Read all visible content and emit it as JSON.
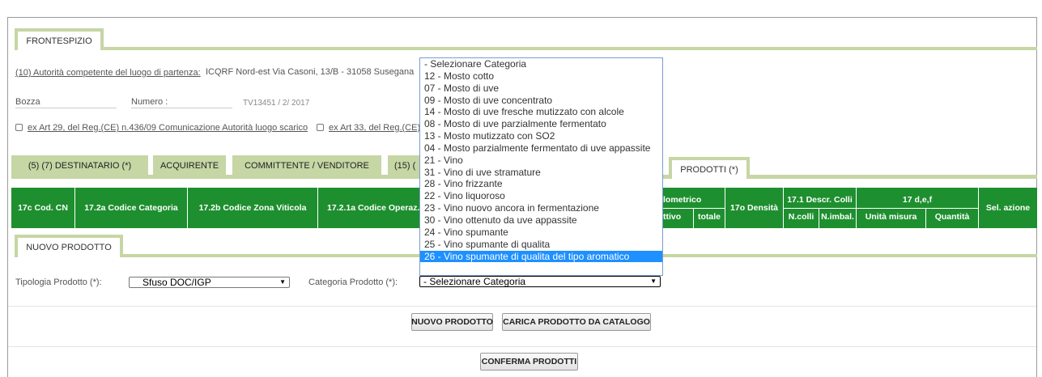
{
  "tabs": {
    "frontespizio": "FRONTESPIZIO",
    "destinatario": "(5) (7) DESTINATARIO (*)",
    "acquirente": "ACQUIRENTE",
    "committente": "COMMITTENTE / VENDITORE",
    "tab15": "(15) (",
    "prodotti": "PRODOTTI (*)",
    "nuovo_prodotto": "NUOVO PRODOTTO"
  },
  "form": {
    "autorita_label": "(10) Autorità competente del luogo di partenza:",
    "autorita_value": "ICQRF Nord-est Via Casoni, 13/B - 31058 Susegana",
    "bozza_label": "Bozza",
    "numero_label": "Numero :",
    "numero_value": "TV13451 / 2/ 2017",
    "checkbox1_label": "ex Art 29, del Reg.(CE) n.436/09 Comunicazione Autorità luogo scarico",
    "checkbox2_label": "ex Art 33, del Reg.(CE) n",
    "tipologia_label": "Tipologia Prodotto (*):",
    "tipologia_value": "Sfuso DOC/IGP",
    "categoria_label": "Categoria Prodotto (*):",
    "categoria_value": "- Selezionare Categoria"
  },
  "table_headers": {
    "cod_cn": "17c Cod. CN",
    "codice_categoria": "17.2a Codice Categoria",
    "codice_zona": "17.2b Codice Zona Viticola",
    "codice_operaz": "17.2.1a Codice Operaz. V",
    "grado_top": "lometrico",
    "grado_effettivo": "ttivo",
    "grado_totale": "totale",
    "densita": "17o Densità",
    "descr_colli": "17.1 Descr. Colli",
    "ncolli": "N.colli",
    "nimbal": "N.imbal.",
    "def": "17 d,e,f",
    "unita_misura": "Unità misura",
    "quantita": "Quantità",
    "sel_azione": "Sel. azione"
  },
  "dropdown": {
    "options": [
      "- Selezionare Categoria",
      "12 - Mosto cotto",
      "07 - Mosto di uve",
      "09 - Mosto di uve concentrato",
      "14 - Mosto di uve fresche mutizzato con alcole",
      "08 - Mosto di uve parzialmente fermentato",
      "13 - Mosto mutizzato con SO2",
      "04 - Mosto parzialmente fermentato di uve appassite",
      "21 - Vino",
      "31 - Vino di uve stramature",
      "28 - Vino frizzante",
      "22 - Vino liquoroso",
      "23 - Vino nuovo ancora in fermentazione",
      "30 - Vino ottenuto da uve appassite",
      "24 - Vino spumante",
      "25 - Vino spumante di qualita",
      "26 - Vino spumante di qualita del tipo aromatico"
    ],
    "highlighted_index": 16
  },
  "buttons": {
    "nuovo_prodotto": "NUOVO PRODOTTO",
    "carica_catalogo": "CARICA PRODOTTO DA CATALOGO",
    "conferma": "CONFERMA PRODOTTI"
  },
  "icons": {
    "select_arrow": "chevron-down-icon"
  },
  "colors": {
    "tab_green": "#c6d6a4",
    "header_green": "#1e8f2f",
    "highlight": "#1e90ff"
  }
}
